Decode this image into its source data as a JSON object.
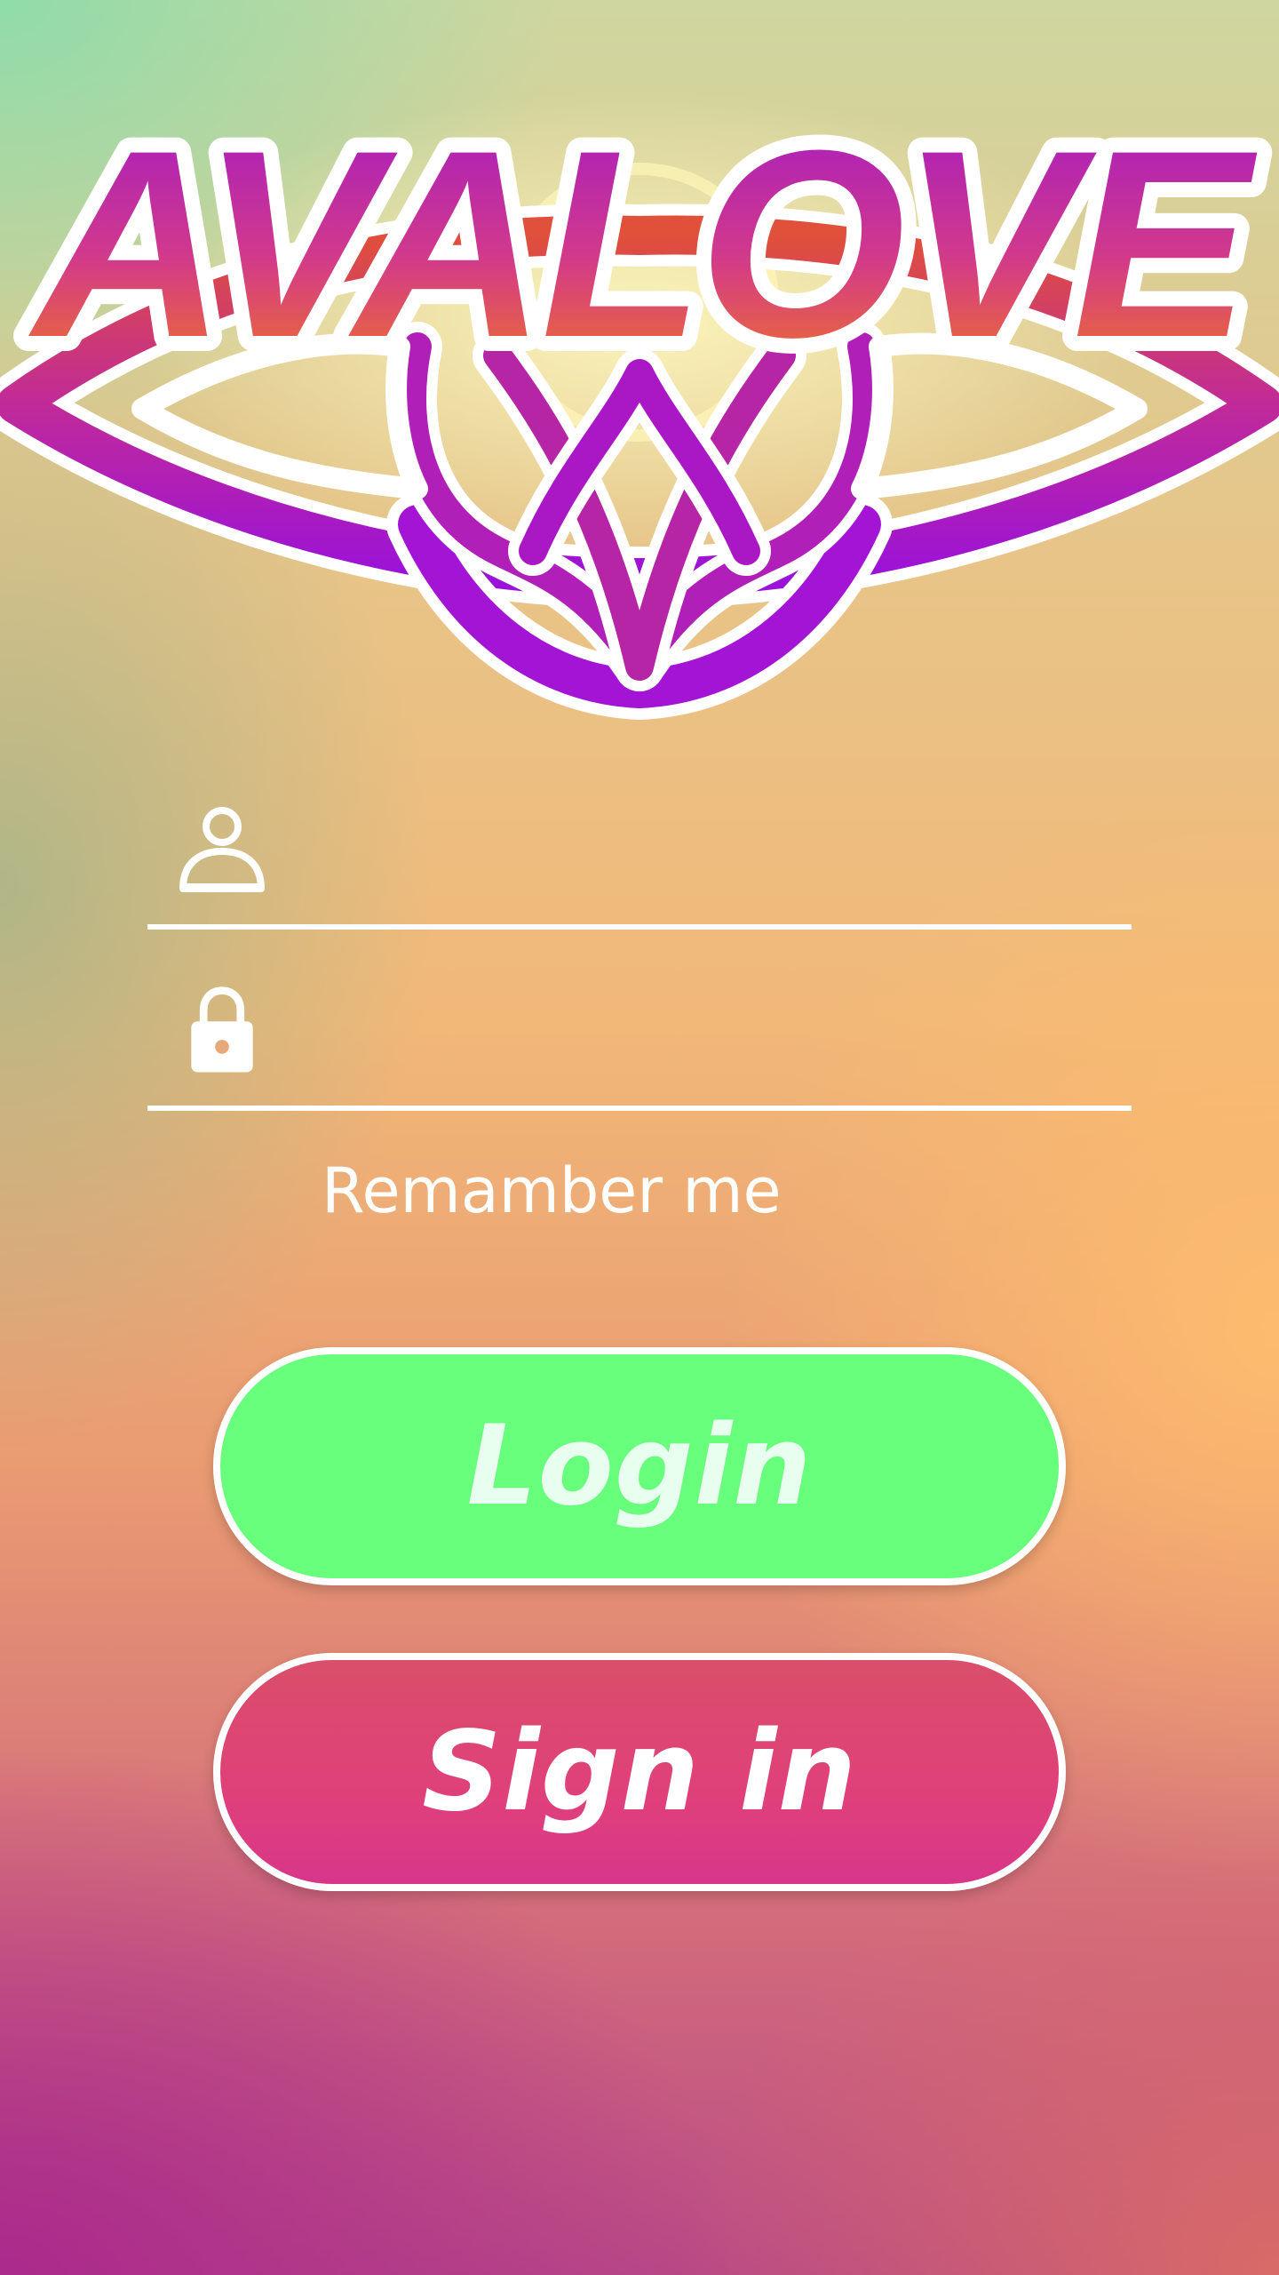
{
  "logo": {
    "text": "AVALOVE",
    "icon": "lotus-heart-logo"
  },
  "form": {
    "username": {
      "icon": "user-icon",
      "value": "",
      "placeholder": ""
    },
    "password": {
      "icon": "lock-icon",
      "value": "",
      "placeholder": ""
    },
    "remember_label": "Remamber me"
  },
  "buttons": {
    "login_label": "Login",
    "signin_label": "Sign in"
  },
  "colors": {
    "login_button": "#68ff7c",
    "signin_button": "#e0407a",
    "logo_purple": "#9b12c8",
    "logo_orange": "#f07a22",
    "field_line": "#ffffff"
  }
}
